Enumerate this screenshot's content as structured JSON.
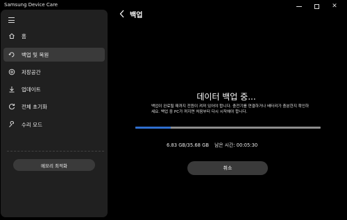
{
  "window": {
    "title": "Samsung Device Care"
  },
  "sidebar": {
    "items": [
      {
        "label": "홈",
        "icon": "home-icon",
        "active": false
      },
      {
        "label": "백업 및 복원",
        "icon": "backup-restore-icon",
        "active": true
      },
      {
        "label": "저장공간",
        "icon": "storage-icon",
        "active": false
      },
      {
        "label": "업데이트",
        "icon": "download-icon",
        "active": false
      },
      {
        "label": "전체 초기화",
        "icon": "reset-icon",
        "active": false
      },
      {
        "label": "수리 모드",
        "icon": "wrench-icon",
        "active": false
      }
    ],
    "memory_button": "메모리 최적화"
  },
  "header": {
    "title": "백업"
  },
  "backup": {
    "status_title": "데이터 백업 중...",
    "description": "백업이 완료될 때까지 전원이 켜져 있어야 합니다. 충전기를 연결하거나 배터리가 충분한지 확인하세요. 백업 중 PC가 꺼지면 처음부터 다시 시작해야 합니다.",
    "progress_fraction": 0.19,
    "progress_text": "6.83 GB/35.68 GB",
    "remaining_text": "남은 시간: 00:05:30",
    "cancel_label": "취소"
  },
  "colors": {
    "accent": "#2f6fd0",
    "sidebar_bg": "#202020",
    "active_item_bg": "#3a3a3a"
  }
}
